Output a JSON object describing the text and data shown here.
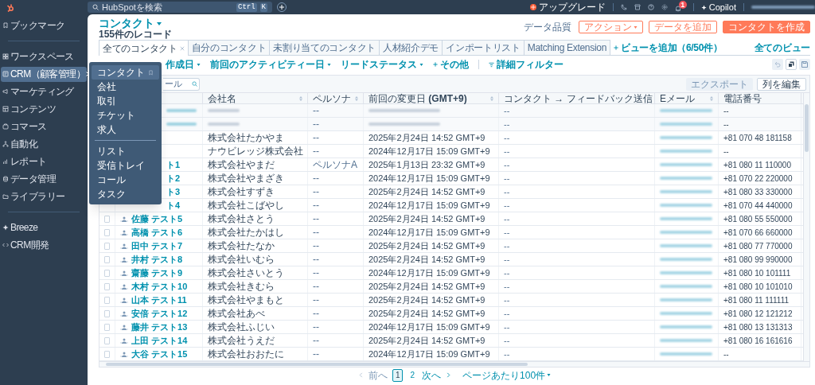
{
  "topbar": {
    "search_placeholder": "HubSpotを検索",
    "shortcut": [
      "Ctrl",
      "K"
    ],
    "upgrade": "アップグレード",
    "notifications": "1",
    "copilot": "Copilot"
  },
  "sidebar": {
    "sections": [
      {
        "items": [
          {
            "label": "ブックマーク",
            "kind": "bookmark",
            "selected": false
          }
        ]
      },
      {
        "items": [
          {
            "label": "ワークスペース",
            "kind": "workspace",
            "selected": false
          },
          {
            "label": "CRM（顧客管理）",
            "kind": "crm",
            "selected": true
          },
          {
            "label": "マーケティング",
            "kind": "marketing",
            "selected": false
          },
          {
            "label": "コンテンツ",
            "kind": "content",
            "selected": false
          },
          {
            "label": "コマース",
            "kind": "commerce",
            "selected": false
          },
          {
            "label": "自動化",
            "kind": "automation",
            "selected": false
          },
          {
            "label": "レポート",
            "kind": "report",
            "selected": false
          },
          {
            "label": "データ管理",
            "kind": "data",
            "selected": false
          },
          {
            "label": "ライブラリー",
            "kind": "library",
            "selected": false
          }
        ]
      },
      {
        "items": [
          {
            "label": "Breeze",
            "kind": "breeze",
            "selected": false
          },
          {
            "label": "CRM開発",
            "kind": "dev",
            "selected": false
          }
        ]
      }
    ]
  },
  "menu": {
    "sections": [
      {
        "items": [
          {
            "label": "コンタクト",
            "selected": true
          },
          {
            "label": "会社",
            "selected": false
          },
          {
            "label": "取引",
            "selected": false
          },
          {
            "label": "チケット",
            "selected": false
          },
          {
            "label": "求人",
            "selected": false
          }
        ]
      },
      {
        "items": [
          {
            "label": "リスト",
            "selected": false
          },
          {
            "label": "受信トレイ",
            "selected": false
          },
          {
            "label": "コール",
            "selected": false
          },
          {
            "label": "タスク",
            "selected": false
          }
        ]
      }
    ]
  },
  "page": {
    "title": "コンタクト",
    "record_count": "155件のレコード",
    "quality": "データ品質",
    "buttons": [
      {
        "label": "アクション",
        "kind": "outline",
        "caret": true
      },
      {
        "label": "データを追加",
        "kind": "outline",
        "caret": false
      },
      {
        "label": "コンタクトを作成",
        "kind": "primary",
        "caret": false
      }
    ]
  },
  "tabs": [
    {
      "label": "全てのコンタクト",
      "selected": true
    },
    {
      "label": "自分のコンタクト",
      "selected": false
    },
    {
      "label": "未割り当てのコンタクト",
      "selected": false
    },
    {
      "label": "人材紹介デモ",
      "selected": false
    },
    {
      "label": "インポートリスト",
      "selected": false
    },
    {
      "label": "Matching Extension",
      "selected": false
    }
  ],
  "add_view": "ビューを追加（6/50件）",
  "all_views": "全てのビュー",
  "filters": [
    {
      "label": "作成日",
      "kind": "dropdown"
    },
    {
      "label": "前回のアクティビティー日",
      "kind": "dropdown"
    },
    {
      "label": "リードステータス",
      "kind": "dropdown"
    },
    {
      "label": "その他",
      "kind": "add"
    },
    {
      "label": "詳細フィルター",
      "kind": "advanced"
    }
  ],
  "search": {
    "placeholder": "ール"
  },
  "table_actions": [
    {
      "label": "エクスポート",
      "disabled": true
    },
    {
      "label": "列を編集",
      "disabled": false
    }
  ],
  "table": {
    "columns": [
      "会社名",
      "ペルソナ",
      "前回の変更日 **(GMT+9)**",
      "コンタクト → フィードバック送信",
      "Eメール",
      "電話番号"
    ],
    "rows": [
      {
        "blurred": true,
        "covered": true,
        "persona": "--",
        "feedback": "--",
        "phone": "--"
      },
      {
        "blurred": true,
        "covered": true,
        "persona": "--",
        "feedback": "--",
        "phone": "--"
      },
      {
        "blurred": false,
        "company": "株式会社たかやま",
        "persona": "--",
        "modified": "2025年2月24日 14:52 GMT+9",
        "feedback": "--",
        "phone": "+81 070 48 181158"
      },
      {
        "blurred": false,
        "company": "ナウビレッジ株式会社",
        "persona": "--",
        "modified": "2024年12月17日 15:09 GMT+9",
        "feedback": "--",
        "phone": "--"
      },
      {
        "blurred": false,
        "covered": true,
        "name": "ト1",
        "company": "株式会社やまだ",
        "persona": "ペルソナA",
        "modified": "2025年1月13日 23:32 GMT+9",
        "feedback": "--",
        "phone": "+81 080 11 110000"
      },
      {
        "blurred": false,
        "covered": true,
        "name": "ト2",
        "company": "株式会社やまざき",
        "persona": "--",
        "modified": "2024年12月17日 15:09 GMT+9",
        "feedback": "--",
        "phone": "+81 070 22 220000"
      },
      {
        "blurred": false,
        "covered": true,
        "name": "ト3",
        "company": "株式会社すずき",
        "persona": "--",
        "modified": "2025年2月24日 14:52 GMT+9",
        "feedback": "--",
        "phone": "+81 080 33 330000"
      },
      {
        "blurred": false,
        "covered": true,
        "name": "ト4",
        "company": "株式会社こばやし",
        "persona": "--",
        "modified": "2024年12月17日 15:09 GMT+9",
        "feedback": "--",
        "phone": "+81 070 44 440000"
      },
      {
        "blurred": false,
        "covered": false,
        "checked": false,
        "name": "佐藤 テスト5",
        "company": "株式会社さとう",
        "persona": "--",
        "modified": "2025年2月24日 14:52 GMT+9",
        "feedback": "--",
        "phone": "+81 080 55 550000"
      },
      {
        "blurred": false,
        "covered": false,
        "checked": false,
        "name": "高橋 テスト6",
        "company": "株式会社たかはし",
        "persona": "--",
        "modified": "2024年12月17日 15:09 GMT+9",
        "feedback": "--",
        "phone": "+81 070 66 660000"
      },
      {
        "blurred": false,
        "covered": false,
        "checked": false,
        "name": "田中 テスト7",
        "company": "株式会社たなか",
        "persona": "--",
        "modified": "2025年2月24日 14:52 GMT+9",
        "feedback": "--",
        "phone": "+81 080 77 770000"
      },
      {
        "blurred": false,
        "covered": false,
        "checked": false,
        "name": "井村 テスト8",
        "company": "株式会社いむら",
        "persona": "--",
        "modified": "2025年2月24日 14:52 GMT+9",
        "feedback": "--",
        "phone": "+81 080 99 990000"
      },
      {
        "blurred": false,
        "covered": false,
        "checked": false,
        "name": "齋藤 テスト9",
        "company": "株式会社さいとう",
        "persona": "--",
        "modified": "2024年12月17日 15:09 GMT+9",
        "feedback": "--",
        "phone": "+81 080 10 101111"
      },
      {
        "blurred": false,
        "covered": false,
        "checked": false,
        "name": "木村 テスト10",
        "company": "株式会社きむら",
        "persona": "--",
        "modified": "2025年2月24日 14:52 GMT+9",
        "feedback": "--",
        "phone": "+81 080 10 101010"
      },
      {
        "blurred": false,
        "covered": false,
        "checked": false,
        "name": "山本 テスト11",
        "company": "株式会社やまもと",
        "persona": "--",
        "modified": "2025年2月24日 14:52 GMT+9",
        "feedback": "--",
        "phone": "+81 080 11 111111"
      },
      {
        "blurred": false,
        "covered": false,
        "checked": false,
        "name": "安倍 テスト12",
        "company": "株式会社あべ",
        "persona": "--",
        "modified": "2025年2月24日 14:52 GMT+9",
        "feedback": "--",
        "phone": "+81 080 12 121212"
      },
      {
        "blurred": false,
        "covered": false,
        "checked": false,
        "name": "藤井 テスト13",
        "company": "株式会社ふじい",
        "persona": "--",
        "modified": "2024年12月17日 15:09 GMT+9",
        "feedback": "--",
        "phone": "+81 080 13 131313"
      },
      {
        "blurred": false,
        "covered": false,
        "checked": false,
        "name": "上田 テスト14",
        "company": "株式会社うえだ",
        "persona": "--",
        "modified": "2025年2月24日 14:52 GMT+9",
        "feedback": "--",
        "phone": "+81 080 16 161616"
      },
      {
        "blurred": false,
        "covered": false,
        "checked": false,
        "name": "大谷 テスト15",
        "company": "株式会社おおたに",
        "persona": "--",
        "modified": "2024年12月17日 15:09 GMT+9",
        "feedback": "--",
        "phone": "--"
      }
    ]
  },
  "pagination": {
    "prev": "前へ",
    "pages": [
      {
        "label": "1",
        "selected": true
      },
      {
        "label": "2",
        "selected": false
      }
    ],
    "next": "次へ",
    "per_page": "ページあたり100件"
  }
}
